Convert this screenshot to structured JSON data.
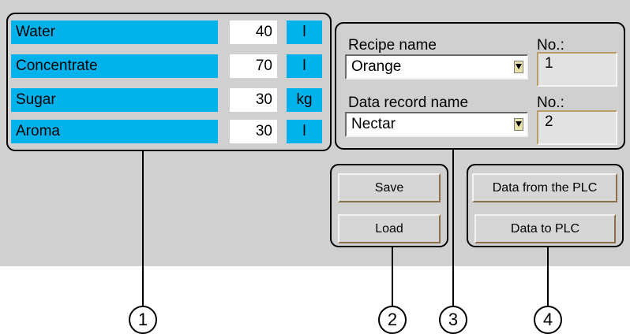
{
  "ingredients": [
    {
      "name": "Water",
      "value": "40",
      "unit": "l"
    },
    {
      "name": "Concentrate",
      "value": "70",
      "unit": "l"
    },
    {
      "name": "Sugar",
      "value": "30",
      "unit": "kg"
    },
    {
      "name": "Aroma",
      "value": "30",
      "unit": "l"
    }
  ],
  "recipe": {
    "name_label": "Recipe name",
    "name_value": "Orange",
    "no_label": "No.:",
    "no_value": "1"
  },
  "data_record": {
    "name_label": "Data record name",
    "name_value": "Nectar",
    "no_label": "No.:",
    "no_value": "2"
  },
  "buttons": {
    "save": "Save",
    "load": "Load",
    "data_from_plc": "Data from the PLC",
    "data_to_plc": "Data to PLC"
  },
  "callouts": [
    "1",
    "2",
    "3",
    "4"
  ],
  "colors": {
    "background": "#d0d0d0",
    "label_fill": "#00b2ec",
    "dropdown_arrow": "#e9e2a8",
    "number_box": "#e2e2e2"
  }
}
